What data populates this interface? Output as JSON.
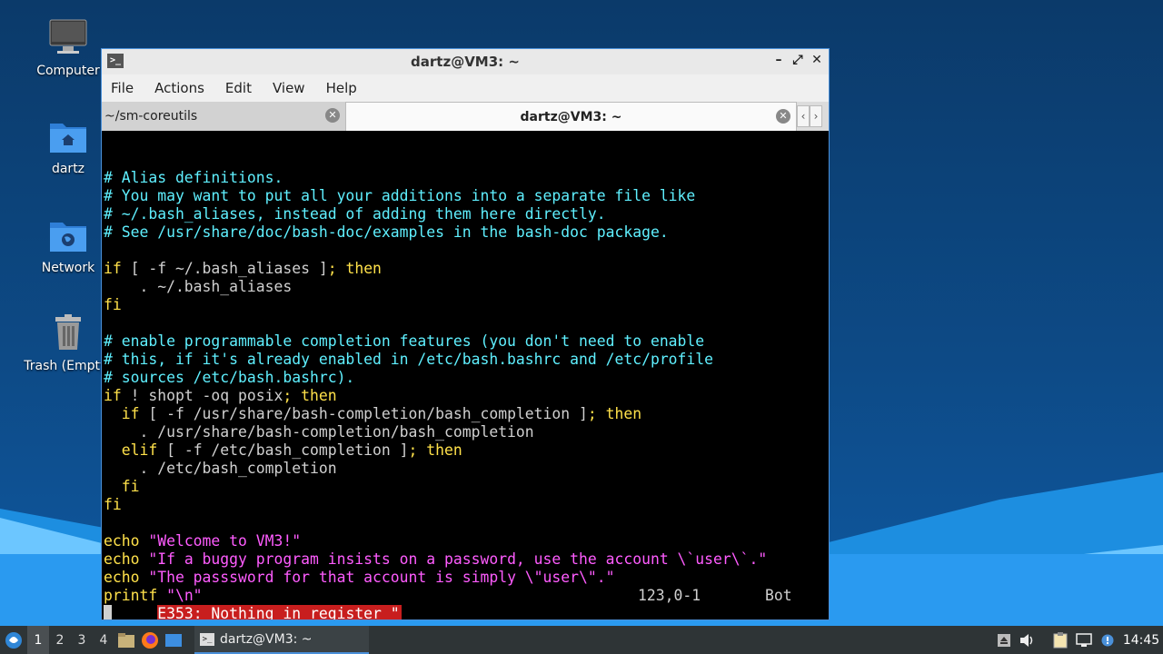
{
  "desktop": {
    "icons": [
      {
        "label": "Computer",
        "icon": "computer-icon"
      },
      {
        "label": "dartz",
        "icon": "home-folder-icon"
      },
      {
        "label": "Network",
        "icon": "network-folder-icon"
      },
      {
        "label": "Trash (Empty)",
        "icon": "trash-icon"
      }
    ]
  },
  "window": {
    "title": "dartz@VM3: ~",
    "controls": {
      "minimize": "–",
      "maximize": "⤢",
      "close": "✕"
    },
    "menu": [
      "File",
      "Actions",
      "Edit",
      "View",
      "Help"
    ],
    "tabs": [
      {
        "label": "~/sm-coreutils",
        "active": false
      },
      {
        "label": "dartz@VM3: ~",
        "active": true
      }
    ],
    "tab_scroll": {
      "left": "‹",
      "right": "›"
    }
  },
  "terminal": {
    "lines": [
      [
        {
          "t": "# Alias definitions.",
          "c": "comment"
        }
      ],
      [
        {
          "t": "# You may want to put all your additions into a separate file like",
          "c": "comment"
        }
      ],
      [
        {
          "t": "# ~/.bash_aliases, instead of adding them here directly.",
          "c": "comment"
        }
      ],
      [
        {
          "t": "# See /usr/share/doc/bash-doc/examples in the bash-doc package.",
          "c": "comment"
        }
      ],
      [],
      [
        {
          "t": "if",
          "c": "kw"
        },
        {
          "t": " [ -f ~/.bash_aliases ]",
          "c": "plain"
        },
        {
          "t": "; then",
          "c": "kw"
        }
      ],
      [
        {
          "t": "    . ~/.bash_aliases",
          "c": "plain"
        }
      ],
      [
        {
          "t": "fi",
          "c": "kw"
        }
      ],
      [],
      [
        {
          "t": "# enable programmable completion features (you don't need to enable",
          "c": "comment"
        }
      ],
      [
        {
          "t": "# this, if it's already enabled in /etc/bash.bashrc and /etc/profile",
          "c": "comment"
        }
      ],
      [
        {
          "t": "# sources /etc/bash.bashrc).",
          "c": "comment"
        }
      ],
      [
        {
          "t": "if",
          "c": "kw"
        },
        {
          "t": " ! shopt -oq posix",
          "c": "plain"
        },
        {
          "t": "; then",
          "c": "kw"
        }
      ],
      [
        {
          "t": "  if",
          "c": "kw"
        },
        {
          "t": " [ -f /usr/share/bash-completion/bash_completion ]",
          "c": "plain"
        },
        {
          "t": "; then",
          "c": "kw"
        }
      ],
      [
        {
          "t": "    . /usr/share/bash-completion/bash_completion",
          "c": "plain"
        }
      ],
      [
        {
          "t": "  elif",
          "c": "kw"
        },
        {
          "t": " [ -f /etc/bash_completion ]",
          "c": "plain"
        },
        {
          "t": "; then",
          "c": "kw"
        }
      ],
      [
        {
          "t": "    . /etc/bash_completion",
          "c": "plain"
        }
      ],
      [
        {
          "t": "  fi",
          "c": "kw"
        }
      ],
      [
        {
          "t": "fi",
          "c": "kw"
        }
      ],
      [],
      [
        {
          "t": "echo ",
          "c": "kw"
        },
        {
          "t": "\"Welcome to VM3!\"",
          "c": "str"
        }
      ],
      [
        {
          "t": "echo ",
          "c": "kw"
        },
        {
          "t": "\"If a buggy program insists on a password, use the account \\`user\\`.\"",
          "c": "str"
        }
      ],
      [
        {
          "t": "echo ",
          "c": "kw"
        },
        {
          "t": "\"The passsword for that account is simply \\\"user\\\".\"",
          "c": "str"
        }
      ],
      [
        {
          "t": "printf ",
          "c": "kw"
        },
        {
          "t": "\"\\n\"",
          "c": "str"
        }
      ]
    ],
    "status": {
      "error": "E353: Nothing in register \"",
      "position": "123,0-1",
      "scroll": "Bot"
    }
  },
  "taskbar": {
    "workspaces": [
      "1",
      "2",
      "3",
      "4"
    ],
    "active_workspace": "1",
    "launchers": [
      "file-manager-icon",
      "firefox-icon",
      "desktop-icon"
    ],
    "task": {
      "label": "dartz@VM3: ~"
    },
    "tray": [
      "eject-icon",
      "volume-icon",
      "clipboard-icon",
      "network-tray-icon",
      "updates-icon"
    ],
    "clock": "14:45"
  }
}
